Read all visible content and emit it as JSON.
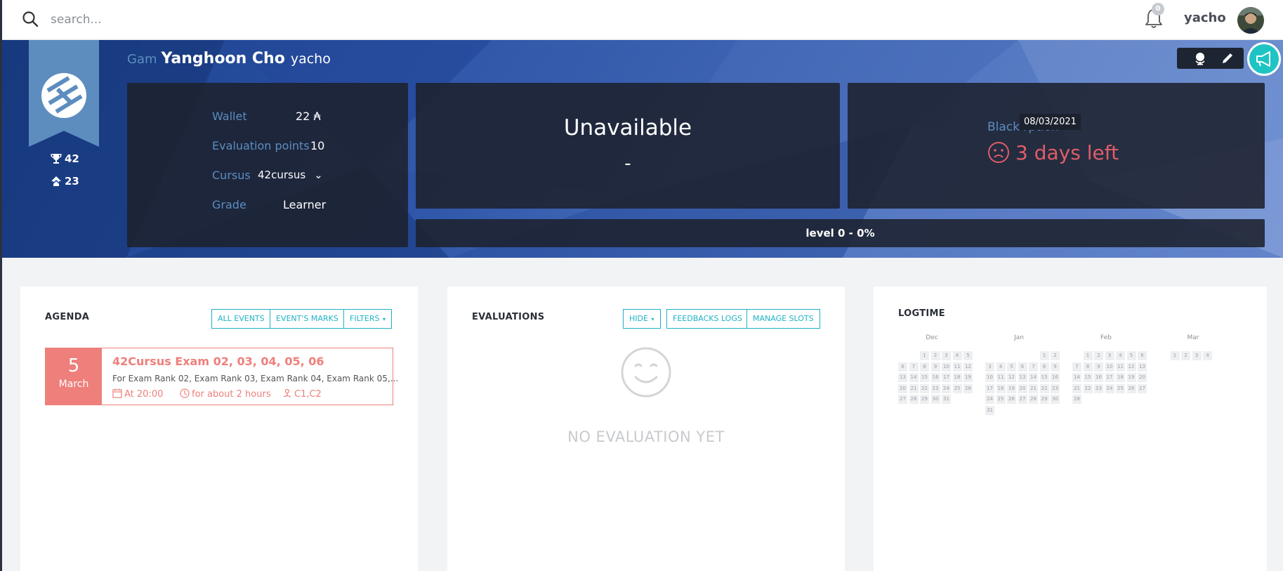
{
  "search": {
    "placeholder": "search..."
  },
  "header": {
    "notification_count": "0",
    "username": "yacho"
  },
  "profile": {
    "name_prefix": "Gam",
    "full_name": "Yanghoon Cho",
    "login": "yacho",
    "trophies": "42",
    "rank": "23",
    "wallet_label": "Wallet",
    "wallet_value": "22 ₳",
    "eval_label": "Evaluation points",
    "eval_value": "10",
    "cursus_label": "Cursus",
    "cursus_value": "42cursus",
    "grade_label": "Grade",
    "grade_value": "Learner"
  },
  "availability": {
    "title": "Unavailable",
    "subtitle": "-"
  },
  "blackhole": {
    "label": "Black       rption",
    "tooltip": "08/03/2021",
    "days_left": "3 days left",
    "color": "#e05c68"
  },
  "level": {
    "text": "level 0 - 0%",
    "percent": 0
  },
  "agenda": {
    "title": "AGENDA",
    "buttons": [
      "ALL EVENTS",
      "EVENT'S MARKS",
      "FILTERS"
    ],
    "event": {
      "day": "5",
      "month": "March",
      "title": "42Cursus Exam 02, 03, 04, 05, 06",
      "description": "For Exam Rank 02, Exam Rank 03, Exam Rank 04, Exam Rank 05,...",
      "time": "At 20:00",
      "duration": "for about 2 hours",
      "location": "C1,C2",
      "color": "#ee7f7b"
    }
  },
  "evaluations": {
    "title": "EVALUATIONS",
    "buttons": [
      "HIDE",
      "FEEDBACKS LOGS",
      "MANAGE SLOTS"
    ],
    "empty_text": "NO EVALUATION YET"
  },
  "logtime": {
    "title": "LOGTIME",
    "months": [
      {
        "name": "Dec",
        "weeks": [
          [
            "",
            "",
            "1",
            "2",
            "3",
            "4",
            "5"
          ],
          [
            "6",
            "7",
            "8",
            "9",
            "10",
            "11",
            "12"
          ],
          [
            "13",
            "14",
            "15",
            "16",
            "17",
            "18",
            "19"
          ],
          [
            "20",
            "21",
            "22",
            "23",
            "24",
            "25",
            "26"
          ],
          [
            "27",
            "28",
            "29",
            "30",
            "31",
            "",
            ""
          ]
        ]
      },
      {
        "name": "Jan",
        "weeks": [
          [
            "",
            "",
            "",
            "",
            "",
            "1",
            "2"
          ],
          [
            "3",
            "4",
            "5",
            "6",
            "7",
            "8",
            "9"
          ],
          [
            "10",
            "11",
            "12",
            "13",
            "14",
            "15",
            "16"
          ],
          [
            "17",
            "18",
            "19",
            "20",
            "21",
            "22",
            "23"
          ],
          [
            "24",
            "25",
            "26",
            "27",
            "28",
            "29",
            "30"
          ],
          [
            "31",
            "",
            "",
            "",
            "",
            "",
            ""
          ]
        ]
      },
      {
        "name": "Feb",
        "weeks": [
          [
            "",
            "1",
            "2",
            "3",
            "4",
            "5",
            "6"
          ],
          [
            "7",
            "8",
            "9",
            "10",
            "11",
            "12",
            "13"
          ],
          [
            "14",
            "15",
            "16",
            "17",
            "18",
            "19",
            "20"
          ],
          [
            "21",
            "22",
            "23",
            "24",
            "25",
            "26",
            "27"
          ],
          [
            "28",
            "",
            "",
            "",
            "",
            "",
            ""
          ]
        ]
      },
      {
        "name": "Mar",
        "weeks": [
          [
            "",
            "1",
            "2",
            "3",
            "4",
            "",
            ""
          ]
        ]
      }
    ]
  },
  "colors": {
    "accent": "#1eb3c6",
    "label_blue": "#5d8dbf",
    "panel": "#1c212e",
    "event": "#ee7f7b"
  }
}
